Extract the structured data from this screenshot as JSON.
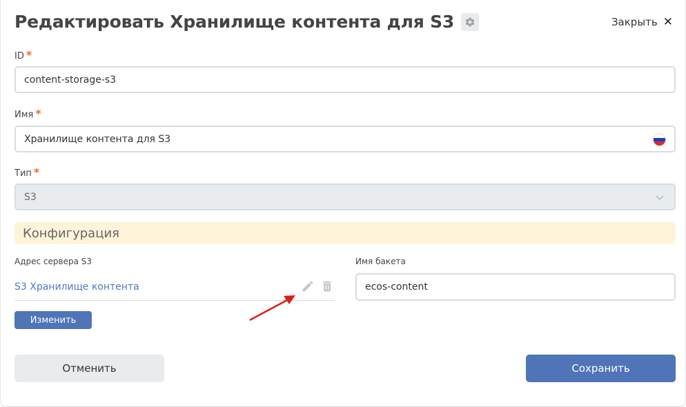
{
  "header": {
    "title": "Редактировать Хранилище контента для S3",
    "settings_icon": "gear-icon",
    "close_label": "Закрыть",
    "close_icon": "close-icon"
  },
  "fields": {
    "id": {
      "label": "ID",
      "required_mark": "*",
      "value": "content-storage-s3"
    },
    "name": {
      "label": "Имя",
      "required_mark": "*",
      "value": "Хранилище контента для S3",
      "locale_icon": "russian-flag-icon"
    },
    "type": {
      "label": "Тип",
      "required_mark": "*",
      "value": "S3",
      "dropdown_icon": "chevron-down-icon"
    }
  },
  "configuration": {
    "section_title": "Конфигурация",
    "server_address": {
      "label": "Адрес сервера S3",
      "value": "S3 Хранилище контента",
      "edit_icon": "pencil-icon",
      "delete_icon": "trash-icon",
      "change_button": "Изменить"
    },
    "bucket": {
      "label": "Имя бакета",
      "value": "ecos-content"
    }
  },
  "footer": {
    "cancel_label": "Отменить",
    "save_label": "Сохранить"
  },
  "annotation": {
    "arrow_color": "#e11b1b"
  },
  "colors": {
    "primary": "#4f74b8",
    "section_bg": "#fdf3d9",
    "required": "#ef6a31",
    "link": "#4a7bbf"
  }
}
